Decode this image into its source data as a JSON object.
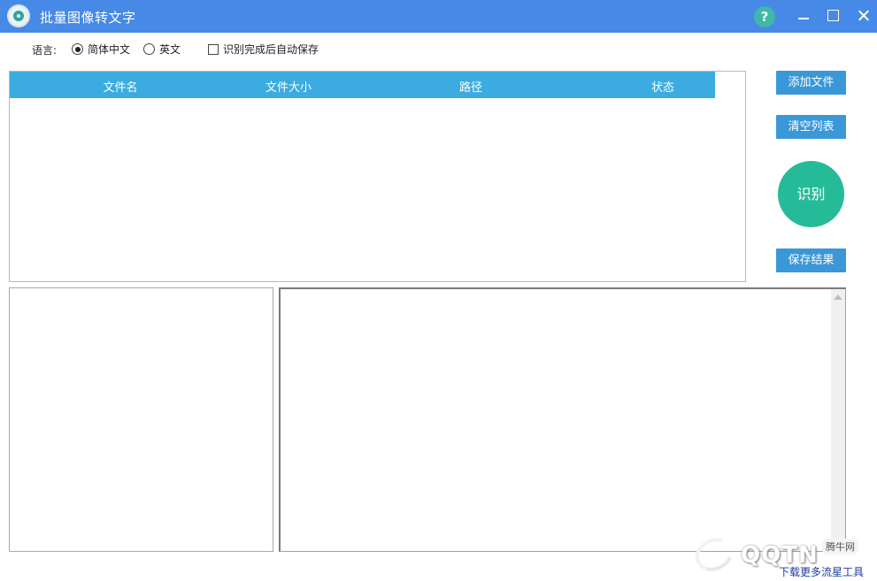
{
  "window": {
    "title": "批量图像转文字",
    "help_label": "?"
  },
  "options": {
    "language_label": "语言:",
    "language_options": [
      {
        "label": "简体中文",
        "selected": true
      },
      {
        "label": "英文",
        "selected": false
      }
    ],
    "auto_save_label": "识别完成后自动保存",
    "auto_save_checked": false
  },
  "file_table": {
    "columns": [
      "文件名",
      "文件大小",
      "路径",
      "状态"
    ],
    "rows": []
  },
  "actions": {
    "add_file": "添加文件",
    "clear_list": "清空列表",
    "recognize": "识别",
    "save_result": "保存结果"
  },
  "footer": {
    "more_tools_link": "下载更多流星工具",
    "watermark_text": "QQTN",
    "watermark_site": "腾牛网"
  },
  "colors": {
    "titlebar": "#4689e6",
    "table_header": "#3cace0",
    "button": "#3a97d8",
    "recognize_button": "#26bb98",
    "help_button": "#3fb7a9"
  },
  "icons": {
    "app": "app-logo-icon",
    "help": "help-icon",
    "minimize": "minimize-icon",
    "maximize": "maximize-icon",
    "close": "close-icon",
    "scroll_up": "scroll-up-arrow-icon"
  }
}
